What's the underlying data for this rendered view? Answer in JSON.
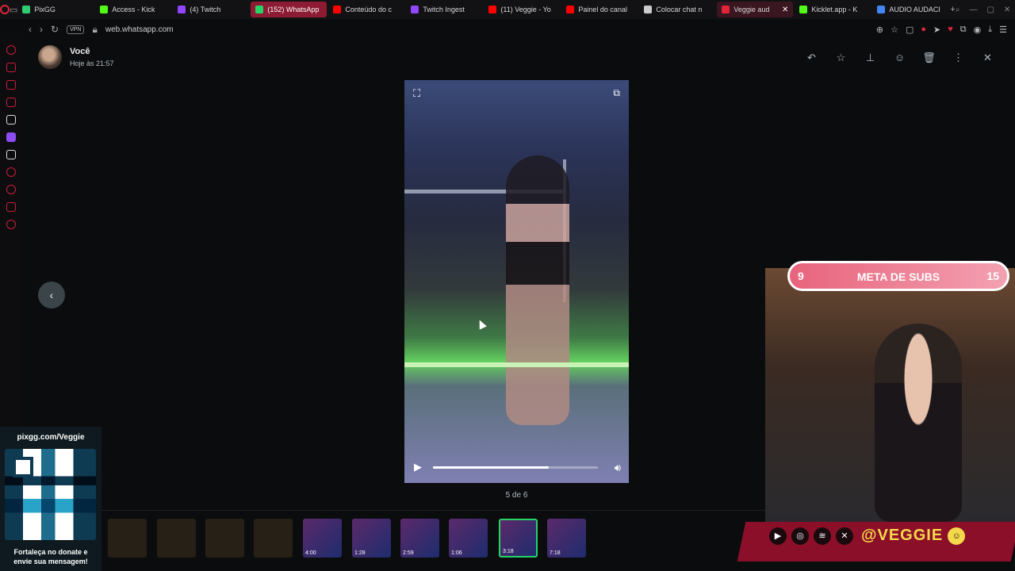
{
  "browser": {
    "tabs": [
      {
        "label": "PixGG",
        "color": "#2ecc71"
      },
      {
        "label": "Access - Kick",
        "color": "#53fc18"
      },
      {
        "label": "(4) Twitch",
        "color": "#9146ff"
      },
      {
        "label": "(152) WhatsApp",
        "color": "#25d366",
        "active": true
      },
      {
        "label": "Conteúdo do c",
        "color": "#ff0000"
      },
      {
        "label": "Twitch Ingest",
        "color": "#9146ff"
      },
      {
        "label": "(11) Veggie - Yo",
        "color": "#ff0000"
      },
      {
        "label": "Painel do canal",
        "color": "#ff0000"
      },
      {
        "label": "Colocar chat n",
        "color": "#cccccc"
      },
      {
        "label": "Veggie aud",
        "color": "#e0243a",
        "pink": true
      },
      {
        "label": "Kicklet.app - K",
        "color": "#53fc18"
      },
      {
        "label": "AUDIO AUDACI",
        "color": "#4285f4"
      }
    ],
    "vpn_label": "VPN",
    "url": "web.whatsapp.com"
  },
  "viewer": {
    "sender_name": "Você",
    "sender_time": "Hoje às 21:57",
    "counter": "5 de 6",
    "progress_fraction": 0.7
  },
  "thumbnails": [
    {
      "type": "doc",
      "duration": ""
    },
    {
      "type": "doc",
      "duration": ""
    },
    {
      "type": "doc",
      "duration": ""
    },
    {
      "type": "doc",
      "duration": ""
    },
    {
      "type": "vid",
      "duration": "4:00"
    },
    {
      "type": "vid",
      "duration": "1:28"
    },
    {
      "type": "vid",
      "duration": "2:59"
    },
    {
      "type": "vid",
      "duration": "1:06"
    },
    {
      "type": "vid",
      "duration": "3:18",
      "selected": true
    },
    {
      "type": "vid",
      "duration": "7:18"
    }
  ],
  "overlay": {
    "pix_title": "pixgg.com/Veggie",
    "pix_caption_1": "Fortaleça no donate e",
    "pix_caption_2": "envie sua mensagem!",
    "subs_current": "9",
    "subs_label": "META DE SUBS",
    "subs_goal": "15",
    "handle": "@VEGGIE"
  }
}
